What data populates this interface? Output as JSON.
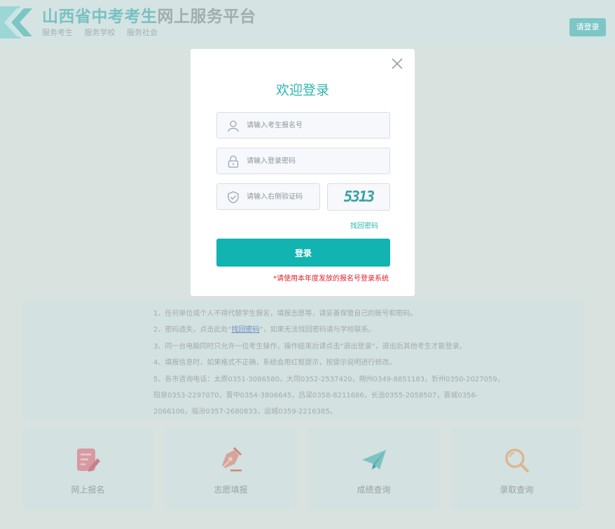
{
  "header": {
    "title_part1": "山西省中考考生",
    "title_part2": "网上服务平台",
    "subnav": [
      "服务考生",
      "服务学校",
      "服务社会"
    ],
    "login_button": "请登录"
  },
  "modal": {
    "title": "欢迎登录",
    "username_placeholder": "请输入考生报名号",
    "password_placeholder": "请输入登录密码",
    "captcha_placeholder": "请输入右侧验证码",
    "captcha_text": "5313",
    "forgot_link": "找回密码",
    "login_button": "登录",
    "note": "*请使用本年度发放的报名号登录系统"
  },
  "notice": {
    "line1": "1、任何单位或个人不得代替学生报名，填报志愿等，请妥善保管自己的账号和密码。",
    "line2_prefix": "2、密码遗失，点击此处“",
    "line2_link": "找回密码",
    "line2_suffix": "”，如果无法找回密码请与学校联系。",
    "line3": "3、同一台电脑同时只允许一位考生操作，操作结束后请点击“退出登录”，退出后其他考生才能登录。",
    "line4": "4、填报信息时，如果格式不正确，系统会用红框提示，按提示说明进行修改。",
    "line5": "5、各市咨询电话：太原0351-3086580，大同0352-2537420，朔州0349-8851183，忻州0350-2027059，",
    "line6": "阳泉0353-2297070，晋中0354-3806645，吕梁0358-8211686，长治0355-2058507，晋城0356-",
    "line7": "2066106，临汾0357-2680833，运城0359-2216385。"
  },
  "cards": [
    {
      "label": "网上报名",
      "icon": "edit-icon",
      "color": "#d79aa3"
    },
    {
      "label": "志愿填报",
      "icon": "pen-nib-icon",
      "color": "#d6a49a"
    },
    {
      "label": "成绩查询",
      "icon": "paper-plane-icon",
      "color": "#7ec3c2"
    },
    {
      "label": "录取查询",
      "icon": "magnifier-icon",
      "color": "#dcb792"
    }
  ]
}
